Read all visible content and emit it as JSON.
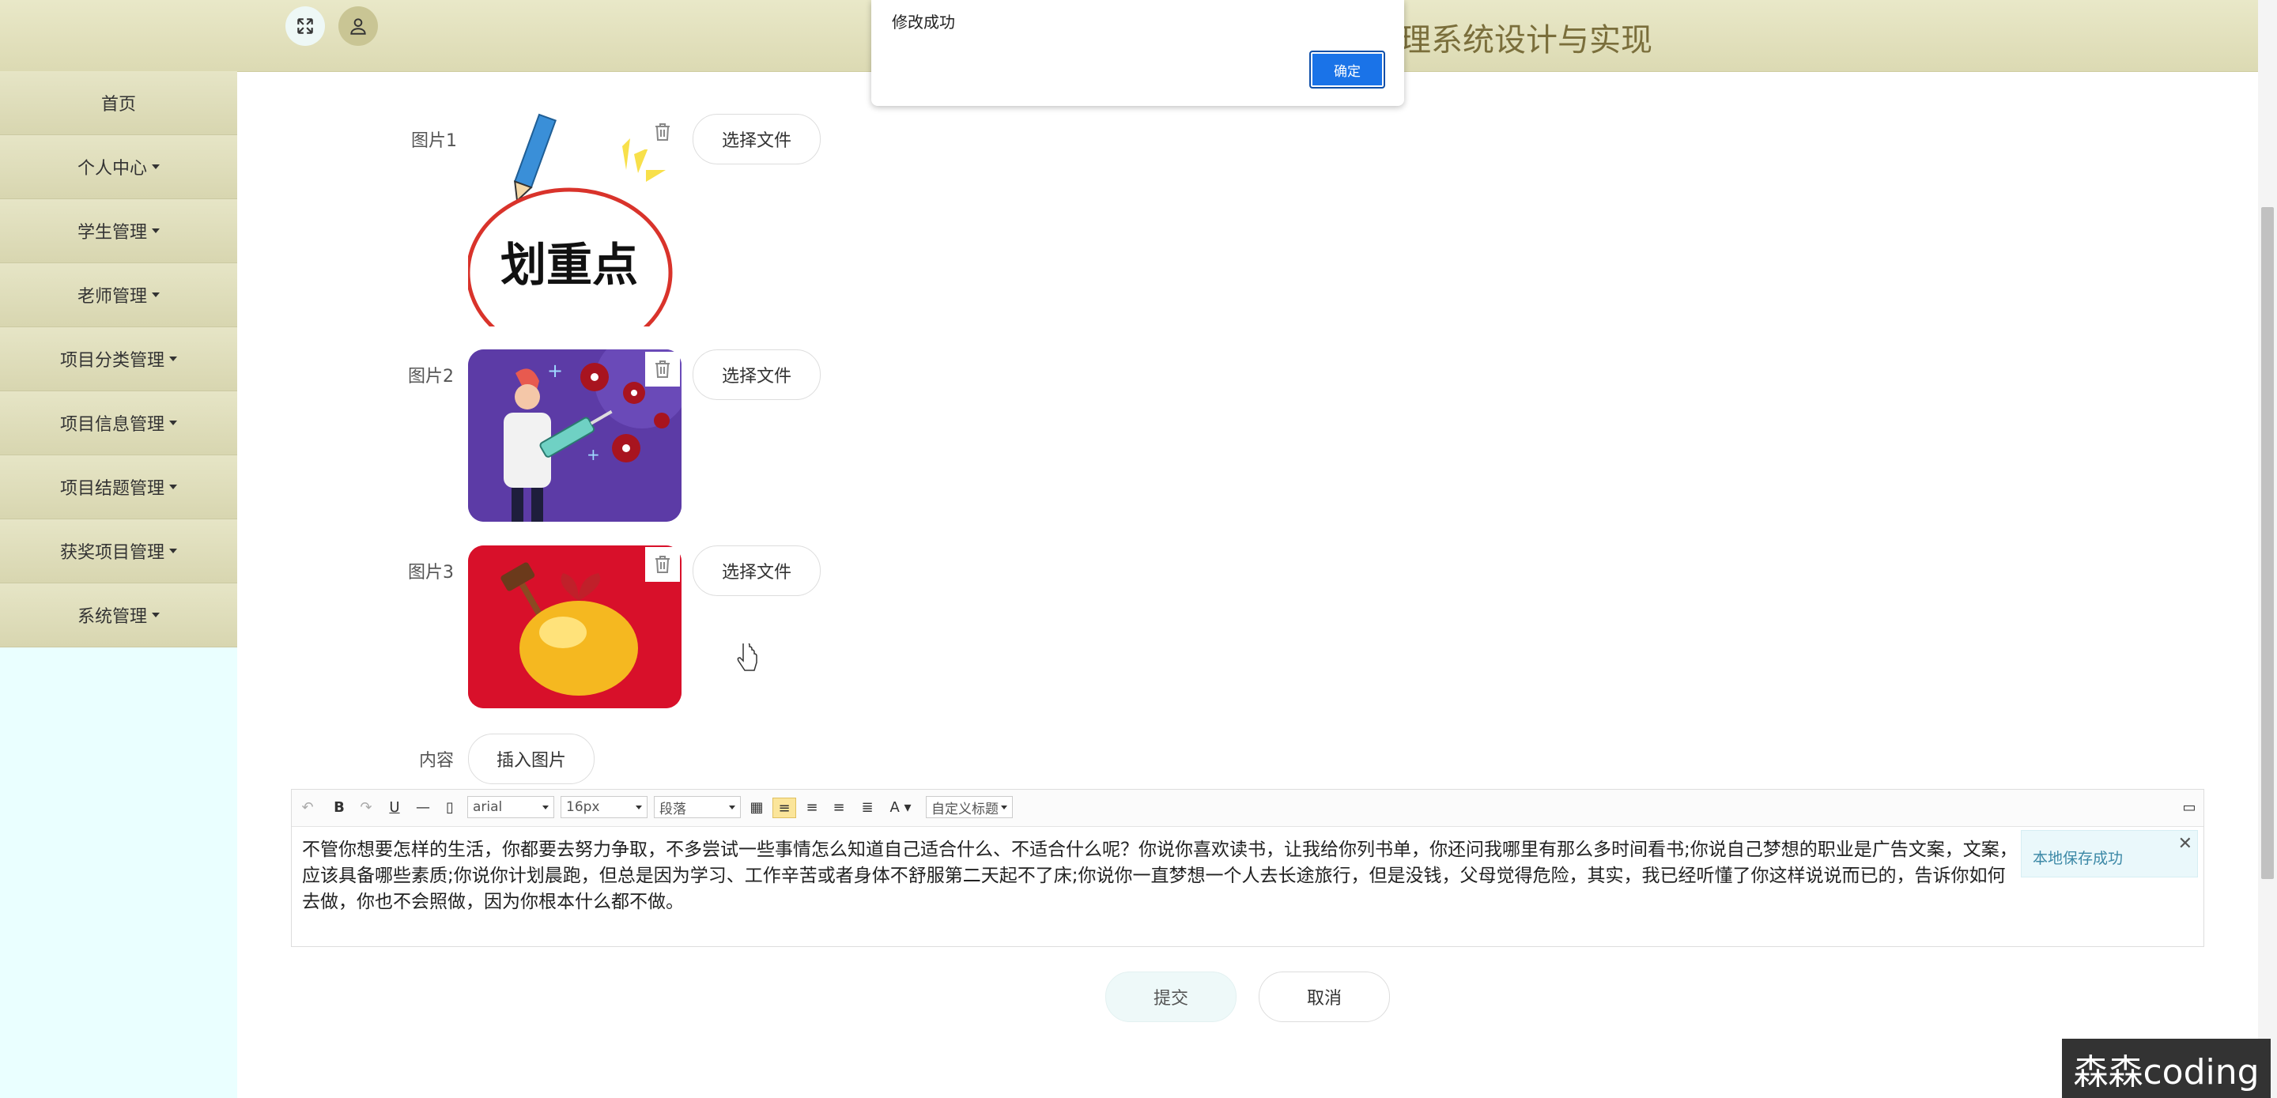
{
  "header": {
    "title": "理系统设计与实现",
    "icons": [
      "expand-icon",
      "user-icon"
    ]
  },
  "sidebar": {
    "items": [
      {
        "label": "首页",
        "has_dropdown": false
      },
      {
        "label": "个人中心",
        "has_dropdown": true
      },
      {
        "label": "学生管理",
        "has_dropdown": true
      },
      {
        "label": "老师管理",
        "has_dropdown": true
      },
      {
        "label": "项目分类管理",
        "has_dropdown": true
      },
      {
        "label": "项目信息管理",
        "has_dropdown": true
      },
      {
        "label": "项目结题管理",
        "has_dropdown": true
      },
      {
        "label": "获奖项目管理",
        "has_dropdown": true
      },
      {
        "label": "系统管理",
        "has_dropdown": true
      }
    ]
  },
  "form": {
    "images": [
      {
        "label": "图片1",
        "choose_label": "选择文件",
        "caption": "划重点"
      },
      {
        "label": "图片2",
        "choose_label": "选择文件"
      },
      {
        "label": "图片3",
        "choose_label": "选择文件"
      }
    ],
    "content_label": "内容",
    "insert_image_label": "插入图片"
  },
  "editor": {
    "font": "arial",
    "size": "16px",
    "paragraph": "段落",
    "custom_title": "自定义标题",
    "text": "不管你想要怎样的生活，你都要去努力争取，不多尝试一些事情怎么知道自己适合什么、不适合什么呢？你说你喜欢读书，让我给你列书单，你还问我哪里有那么多时间看书;你说自己梦想的职业是广告文案，文案，应该具备哪些素质;你说你计划晨跑，但总是因为学习、工作辛苦或者身体不舒服第二天起不了床;你说你一直梦想一个人去长途旅行，但是没钱，父母觉得危险，其实，我已经听懂了你这样说说而已的，告诉你如何去做，你也不会照做，因为你根本什么都不做。",
    "toast": "本地保存成功"
  },
  "actions": {
    "submit": "提交",
    "cancel": "取消"
  },
  "alert": {
    "message": "修改成功",
    "ok": "确定"
  },
  "watermark": "森森coding",
  "colors": {
    "header_bg": "#dcdab3",
    "sidebar_bg": "#eaffff",
    "accent": "#1a73e8",
    "title_color": "#7a6e3b"
  }
}
